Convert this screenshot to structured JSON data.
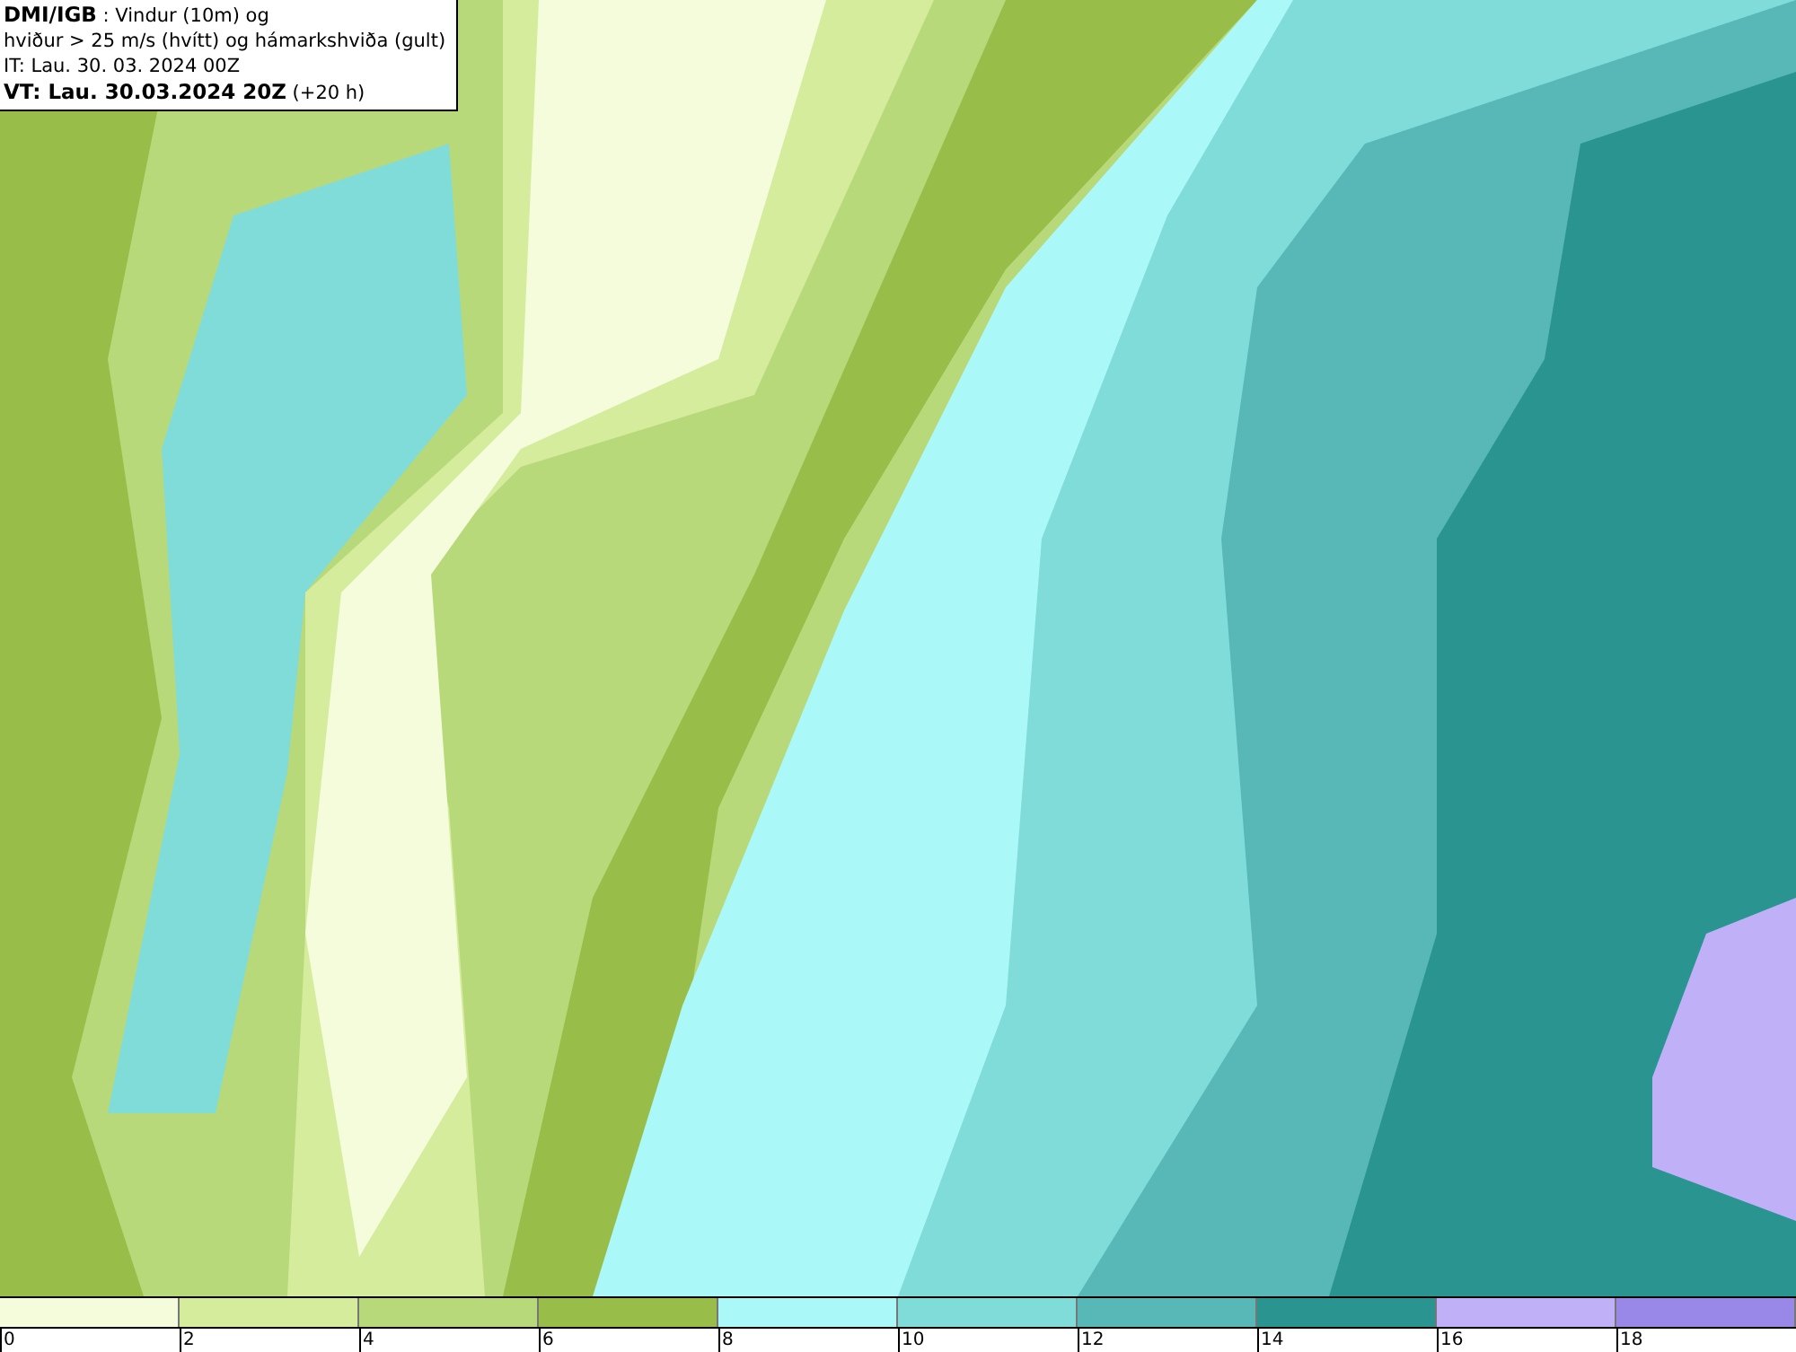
{
  "legend": {
    "lines": [
      "**DMI/IGB** : Vindur (10m) og",
      "hviður > 25 m/s (hvítt) og hámarkshviða (gult)",
      "IT: Lau. 30. 03. 2024 00Z",
      "**VT: Lau. 30.03.2024 20Z** (+20 h)"
    ]
  },
  "colorbar": [
    {
      "label": "0",
      "color": "#f5fcdc"
    },
    {
      "label": "2",
      "color": "#d4ec9c"
    },
    {
      "label": "4",
      "color": "#b8d97a"
    },
    {
      "label": "6",
      "color": "#98bd48"
    },
    {
      "label": "8",
      "color": "#aaf8f8"
    },
    {
      "label": "10",
      "color": "#80dcd8"
    },
    {
      "label": "12",
      "color": "#58b8b8"
    },
    {
      "label": "14",
      "color": "#2a9490"
    },
    {
      "label": "16",
      "color": "#c0b0f8"
    },
    {
      "label": "18",
      "color": "#9a88e8"
    }
  ]
}
